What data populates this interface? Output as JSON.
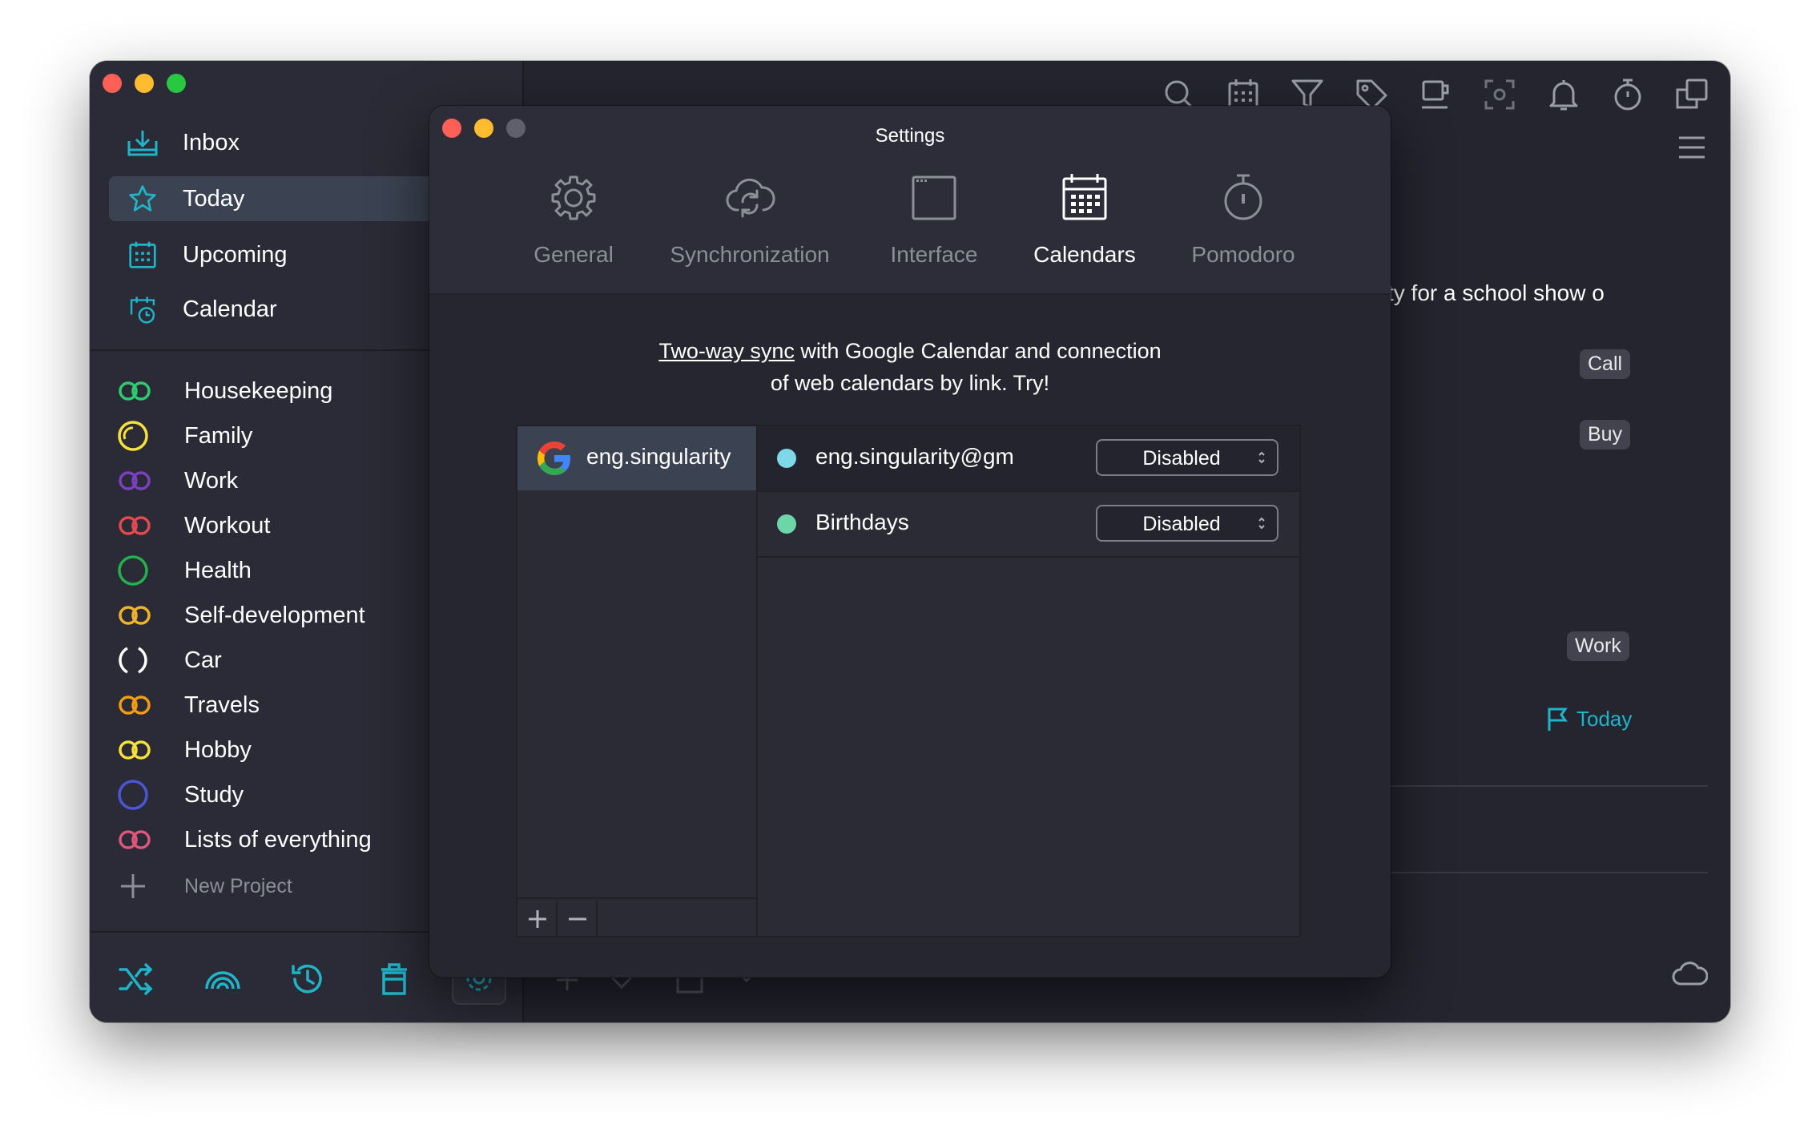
{
  "sidebar": {
    "nav": [
      {
        "label": "Inbox",
        "icon": "inbox-icon"
      },
      {
        "label": "Today",
        "icon": "star-icon",
        "active": true
      },
      {
        "label": "Upcoming",
        "icon": "calendar-grid-icon"
      },
      {
        "label": "Calendar",
        "icon": "calendar-clock-icon"
      }
    ],
    "projects": [
      {
        "label": "Housekeeping",
        "color": "#2ecc71",
        "icon": "double-ring-icon"
      },
      {
        "label": "Family",
        "color": "#f5e13a",
        "icon": "progress-circle-icon"
      },
      {
        "label": "Work",
        "color": "#7b3fc4",
        "icon": "double-ring-icon"
      },
      {
        "label": "Workout",
        "color": "#e5484d",
        "icon": "double-ring-icon"
      },
      {
        "label": "Health",
        "color": "#22b14c",
        "icon": "circle-icon"
      },
      {
        "label": "Self-development",
        "color": "#f0b429",
        "icon": "double-ring-icon"
      },
      {
        "label": "Car",
        "color": "#ffffff",
        "icon": "dashed-circle-icon"
      },
      {
        "label": "Travels",
        "color": "#f39c12",
        "icon": "double-ring-icon"
      },
      {
        "label": "Hobby",
        "color": "#f5e13a",
        "icon": "double-ring-icon"
      },
      {
        "label": "Study",
        "color": "#4a55d8",
        "icon": "circle-icon"
      },
      {
        "label": "Lists of everything",
        "color": "#e0557a",
        "icon": "double-ring-icon"
      }
    ],
    "new_project": "New Project"
  },
  "colors": {
    "accent": "#1fb5c9",
    "sidebar_bg": "#2a2b36",
    "window_bg": "#24252f",
    "dialog_bg": "#2c2d38"
  },
  "main": {
    "task_fragment": "ty for a school show o",
    "tags": [
      "Call",
      "Buy",
      "Work"
    ],
    "today_label": "Today"
  },
  "settings": {
    "title": "Settings",
    "tabs": [
      {
        "label": "General",
        "icon": "gear-icon"
      },
      {
        "label": "Synchronization",
        "icon": "cloud-sync-icon"
      },
      {
        "label": "Interface",
        "icon": "window-icon"
      },
      {
        "label": "Calendars",
        "icon": "calendar-icon",
        "active": true
      },
      {
        "label": "Pomodoro",
        "icon": "stopwatch-icon"
      }
    ],
    "intro_link": "Two-way sync",
    "intro_line1_rest": " with Google Calendar and connection",
    "intro_line2": "of web calendars by link. Try!",
    "accounts": [
      {
        "label": "eng.singularity",
        "icon": "google-icon"
      }
    ],
    "calendars": [
      {
        "name": "eng.singularity@gm",
        "status": "Disabled",
        "color": "#7fd8e8"
      },
      {
        "name": "Birthdays",
        "status": "Disabled",
        "color": "#6dd6a8"
      }
    ]
  }
}
